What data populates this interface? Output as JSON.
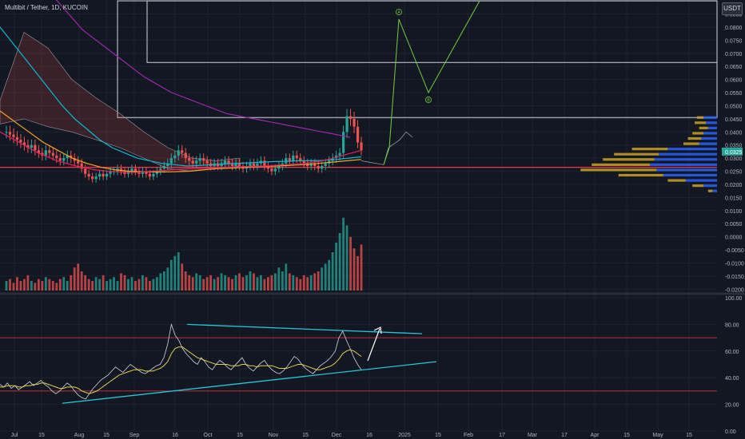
{
  "header": {
    "symbol_title": "Multibit / Tether, 1D, KUCOIN",
    "currency": "USDT"
  },
  "colors": {
    "background": "#131722",
    "grid": "#1e222d",
    "up": "#26a69a",
    "down": "#ef5350",
    "ma_magenta": "#9c27b0",
    "ma_cyan": "#00bcd4",
    "ma_orange": "#f6a623",
    "ma_red": "#e91e63",
    "projection": "#6fcf3f",
    "rsi": "#d1d4dc",
    "rsi_ma": "#e1d04b",
    "trend": "#26c6da",
    "level": "#f23645",
    "vp_buy": "#2962ff",
    "vp_sell": "#c9a227"
  },
  "chart_data": [
    {
      "type": "candlestick",
      "panel": "price",
      "x_ticks": [
        "Jul",
        "15",
        "Aug",
        "15",
        "Sep",
        "16",
        "Oct",
        "15",
        "Nov",
        "15",
        "Dec",
        "16",
        "2025",
        "15",
        "Feb",
        "17",
        "Mar",
        "17",
        "Apr",
        "15",
        "May",
        "15"
      ],
      "y_ticks": [
        "0.0850",
        "0.0800",
        "0.0750",
        "0.0700",
        "0.0650",
        "0.0600",
        "0.0550",
        "0.0500",
        "0.0450",
        "0.0400",
        "0.0350",
        "0.0300",
        "0.0250",
        "0.0200",
        "0.0150",
        "0.0100",
        "0.0050",
        "0.0000",
        "-0.0050",
        "-0.0100",
        "-0.0150",
        "-0.0200"
      ],
      "ylim": [
        -0.0205,
        0.0885
      ],
      "last_price": "0.0325",
      "horizontal_level": 0.0265,
      "close_series": [
        0.04,
        0.039,
        0.038,
        0.037,
        0.036,
        0.035,
        0.034,
        0.035,
        0.033,
        0.032,
        0.031,
        0.033,
        0.032,
        0.031,
        0.03,
        0.029,
        0.03,
        0.031,
        0.03,
        0.029,
        0.028,
        0.026,
        0.024,
        0.023,
        0.022,
        0.023,
        0.024,
        0.023,
        0.024,
        0.025,
        0.025,
        0.026,
        0.025,
        0.024,
        0.025,
        0.026,
        0.025,
        0.024,
        0.025,
        0.024,
        0.023,
        0.024,
        0.025,
        0.026,
        0.027,
        0.028,
        0.03,
        0.031,
        0.033,
        0.032,
        0.03,
        0.029,
        0.028,
        0.029,
        0.03,
        0.029,
        0.028,
        0.027,
        0.028,
        0.027,
        0.028,
        0.029,
        0.028,
        0.027,
        0.028,
        0.027,
        0.026,
        0.027,
        0.028,
        0.027,
        0.028,
        0.029,
        0.027,
        0.026,
        0.025,
        0.026,
        0.027,
        0.028,
        0.03,
        0.029,
        0.031,
        0.03,
        0.029,
        0.028,
        0.027,
        0.028,
        0.027,
        0.026,
        0.027,
        0.028,
        0.029,
        0.03,
        0.031,
        0.032,
        0.04,
        0.046,
        0.045,
        0.042,
        0.036,
        0.033
      ],
      "volume_series": [
        5,
        6,
        4,
        7,
        5,
        6,
        8,
        5,
        4,
        6,
        5,
        7,
        6,
        5,
        4,
        6,
        7,
        5,
        8,
        12,
        14,
        10,
        8,
        6,
        5,
        7,
        6,
        8,
        5,
        6,
        7,
        5,
        9,
        8,
        6,
        7,
        5,
        6,
        8,
        7,
        5,
        6,
        7,
        9,
        10,
        12,
        16,
        18,
        20,
        14,
        10,
        8,
        7,
        9,
        8,
        6,
        7,
        8,
        6,
        7,
        9,
        8,
        7,
        6,
        8,
        9,
        7,
        8,
        10,
        9,
        7,
        8,
        6,
        7,
        8,
        9,
        12,
        10,
        14,
        9,
        8,
        7,
        6,
        8,
        7,
        8,
        9,
        10,
        12,
        14,
        16,
        20,
        25,
        30,
        38,
        34,
        28,
        22,
        18,
        24
      ],
      "ma_series": [
        {
          "name": "",
          "color": "#9c27b0",
          "values": [
            0.115,
            0.112,
            0.109,
            0.106,
            0.103,
            0.1,
            0.097,
            0.094,
            0.091,
            0.088,
            0.085,
            0.082,
            0.079,
            0.077,
            0.075,
            0.073,
            0.071,
            0.069,
            0.067,
            0.065,
            0.063,
            0.061,
            0.0595,
            0.058,
            0.0565,
            0.055,
            0.054,
            0.053,
            0.052,
            0.051,
            0.05,
            0.049,
            0.048,
            0.047,
            0.0465,
            0.046,
            0.0455,
            0.045,
            0.0445,
            0.044,
            0.0435,
            0.043,
            0.0425,
            0.042,
            0.0415,
            0.041,
            0.0405,
            0.04,
            0.0395,
            0.039,
            0.0385,
            0.038
          ]
        },
        {
          "name": "",
          "color": "#00bcd4",
          "values": [
            0.08,
            0.074,
            0.068,
            0.062,
            0.056,
            0.05,
            0.045,
            0.041,
            0.037,
            0.034,
            0.032,
            0.03,
            0.029,
            0.028,
            0.0275,
            0.027,
            0.0272,
            0.0275,
            0.0278,
            0.028,
            0.0282,
            0.0285,
            0.0287,
            0.0288,
            0.029,
            0.029,
            0.0292,
            0.0295,
            0.03,
            0.0305
          ]
        },
        {
          "name": "",
          "color": "#f6a623",
          "values": [
            0.048,
            0.044,
            0.04,
            0.036,
            0.033,
            0.03,
            0.028,
            0.0265,
            0.0255,
            0.025,
            0.0248,
            0.0247,
            0.0248,
            0.025,
            0.0255,
            0.026,
            0.0262,
            0.0265,
            0.0268,
            0.027,
            0.0272,
            0.0275,
            0.028,
            0.0285,
            0.029,
            0.0295
          ]
        },
        {
          "name": "",
          "color": "#e91e63",
          "values": [
            0.04,
            0.036,
            0.032,
            0.029,
            0.027,
            0.0255,
            0.0248,
            0.0245,
            0.025,
            0.0255,
            0.026,
            0.0262,
            0.0265,
            0.0268,
            0.027,
            0.0275,
            0.028,
            0.029,
            0.031,
            0.033
          ]
        }
      ],
      "projection_path": [
        [
          0.0275,
          "Dec 16"
        ],
        [
          0.034,
          "Dec 21"
        ],
        [
          0.083,
          "Dec 25"
        ],
        [
          0.055,
          "Jan 10"
        ],
        [
          0.09,
          "Jan 31"
        ]
      ],
      "projection_labels": [
        "A",
        "B"
      ],
      "resistance_box": {
        "top": 0.09,
        "bottom": 0.0455
      },
      "target_box": {
        "top": 0.09,
        "bottom": 0.0665
      },
      "volume_profile": [
        {
          "price": 0.0455,
          "buy": 0.6,
          "sell": 0.3
        },
        {
          "price": 0.0435,
          "buy": 0.5,
          "sell": 0.5
        },
        {
          "price": 0.0415,
          "buy": 0.4,
          "sell": 0.4
        },
        {
          "price": 0.0395,
          "buy": 0.6,
          "sell": 0.5
        },
        {
          "price": 0.0375,
          "buy": 0.7,
          "sell": 0.6
        },
        {
          "price": 0.0355,
          "buy": 0.8,
          "sell": 0.7
        },
        {
          "price": 0.0335,
          "buy": 2.2,
          "sell": 1.6
        },
        {
          "price": 0.0315,
          "buy": 2.6,
          "sell": 2.0
        },
        {
          "price": 0.0295,
          "buy": 2.8,
          "sell": 2.3
        },
        {
          "price": 0.0275,
          "buy": 3.0,
          "sell": 2.6
        },
        {
          "price": 0.0255,
          "buy": 2.7,
          "sell": 3.4
        },
        {
          "price": 0.0235,
          "buy": 2.4,
          "sell": 2.0
        },
        {
          "price": 0.0215,
          "buy": 1.4,
          "sell": 0.8
        },
        {
          "price": 0.0195,
          "buy": 0.6,
          "sell": 0.5
        },
        {
          "price": 0.0175,
          "buy": 0.2,
          "sell": 0.2
        }
      ]
    },
    {
      "type": "line",
      "panel": "rsi",
      "y_ticks": [
        "100.00",
        "80.00",
        "60.00",
        "40.00",
        "20.00",
        "0.00"
      ],
      "ylim": [
        0,
        100
      ],
      "overbought": 70,
      "oversold": 30,
      "series": [
        {
          "name": "",
          "values": [
            35,
            33,
            36,
            32,
            34,
            31,
            33,
            35,
            37,
            34,
            36,
            38,
            35,
            33,
            30,
            28,
            30,
            33,
            36,
            34,
            30,
            27,
            25,
            24,
            28,
            32,
            35,
            38,
            40,
            42,
            45,
            48,
            46,
            44,
            47,
            50,
            48,
            46,
            44,
            43,
            45,
            47,
            49,
            50,
            55,
            65,
            80,
            72,
            68,
            62,
            58,
            55,
            52,
            50,
            55,
            52,
            48,
            46,
            50,
            53,
            51,
            48,
            46,
            49,
            52,
            55,
            50,
            47,
            45,
            48,
            51,
            53,
            49,
            46,
            44,
            43,
            45,
            48,
            52,
            56,
            54,
            50,
            47,
            45,
            43,
            46,
            49,
            51,
            53,
            56,
            60,
            70,
            75,
            68,
            62,
            55,
            50,
            46
          ]
        },
        {
          "name": "",
          "values": [
            33,
            33,
            34,
            34,
            34,
            33,
            33,
            34,
            34,
            35,
            35,
            36,
            36,
            35,
            34,
            33,
            32,
            32,
            33,
            33,
            33,
            32,
            30,
            29,
            28,
            29,
            30,
            32,
            34,
            36,
            38,
            40,
            42,
            43,
            44,
            45,
            46,
            46,
            46,
            45,
            45,
            45,
            46,
            47,
            49,
            52,
            58,
            62,
            63,
            63,
            61,
            59,
            57,
            55,
            54,
            53,
            52,
            51,
            50,
            50,
            50,
            50,
            49,
            49,
            49,
            50,
            50,
            49,
            49,
            48,
            49,
            49,
            49,
            49,
            48,
            47,
            47,
            47,
            48,
            49,
            50,
            50,
            49,
            48,
            47,
            46,
            46,
            47,
            48,
            49,
            51,
            54,
            58,
            60,
            61,
            60,
            58,
            56
          ]
        }
      ],
      "upper_trendline": [
        [
          80,
          "Sep 20"
        ],
        [
          73,
          "Dec 25"
        ]
      ],
      "lower_trendline": [
        [
          22,
          "Jul 31"
        ],
        [
          52,
          "Jan 15"
        ]
      ]
    }
  ]
}
